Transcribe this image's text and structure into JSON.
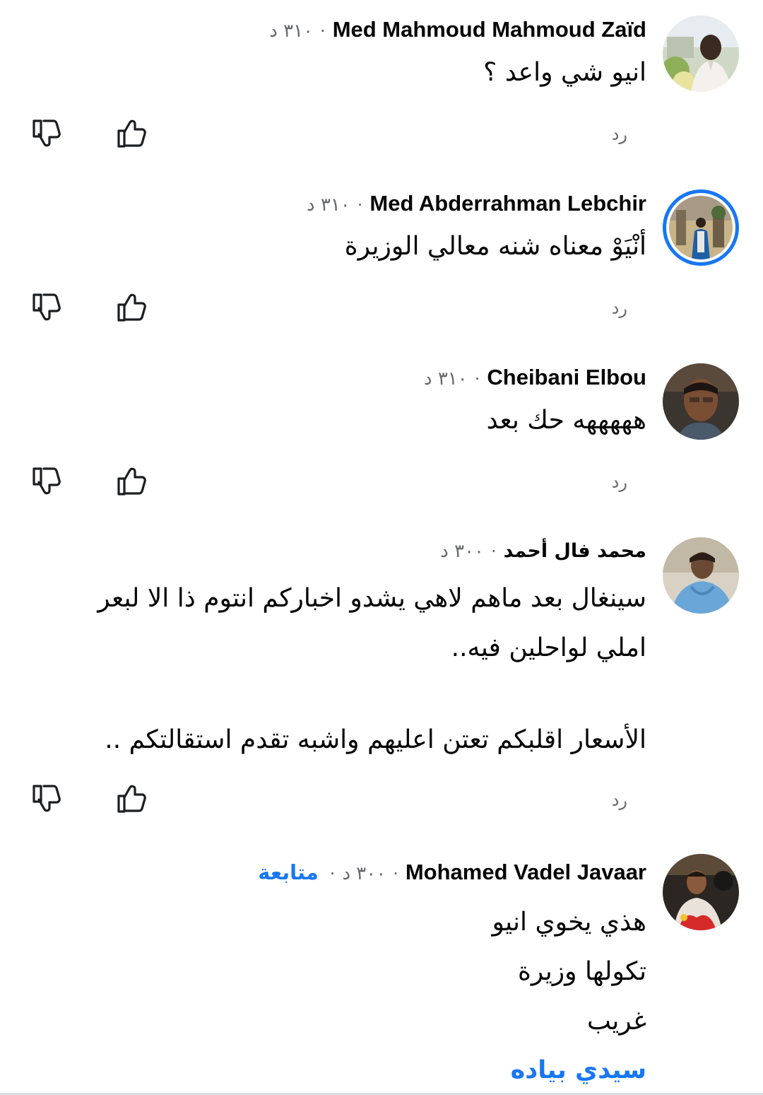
{
  "colors": {
    "link": "#1877f2",
    "secondary_text": "#65676b",
    "primary_text": "#050505"
  },
  "comments": [
    {
      "author": "Med Mahmoud Mahmoud Zaïd",
      "time": "٣١٠ د",
      "lines": [
        "انيو شي واعد ؟"
      ],
      "reply_label": "رد",
      "avatar_icon": "avatar-photo"
    },
    {
      "author": "Med Abderrahman Lebchir",
      "time": "٣١٠ د",
      "lines": [
        "أنْيَوْ معناه شنه معالي الوزيرة"
      ],
      "reply_label": "رد",
      "avatar_icon": "avatar-photo-story-ring"
    },
    {
      "author": "Cheibani Elbou",
      "time": "٣١٠ د",
      "lines": [
        "هههههه حك بعد"
      ],
      "reply_label": "رد",
      "avatar_icon": "avatar-photo"
    },
    {
      "author": "محمد فال أحمد",
      "time": "٣٠٠ د",
      "lines": [
        "سينغال بعد ماهم لاهي يشدو اخباركم انتوم ذا الا لبعر",
        "املي لواحلين فيه..",
        "الأسعار اقلبكم تعتن اعليهم واشبه تقدم استقالتكم .."
      ],
      "reply_label": "رد",
      "avatar_icon": "avatar-photo"
    },
    {
      "author": "Mohamed Vadel Javaar",
      "time": "٣٠٠ د",
      "follow_label": "متابعة",
      "lines": [
        "هذي يخوي انيو",
        "تكولها وزيرة",
        "غريب"
      ],
      "mention": "سيدي بياده",
      "avatar_icon": "avatar-photo"
    }
  ],
  "icons": {
    "like": "thumbs-up-icon",
    "dislike": "thumbs-down-icon"
  }
}
